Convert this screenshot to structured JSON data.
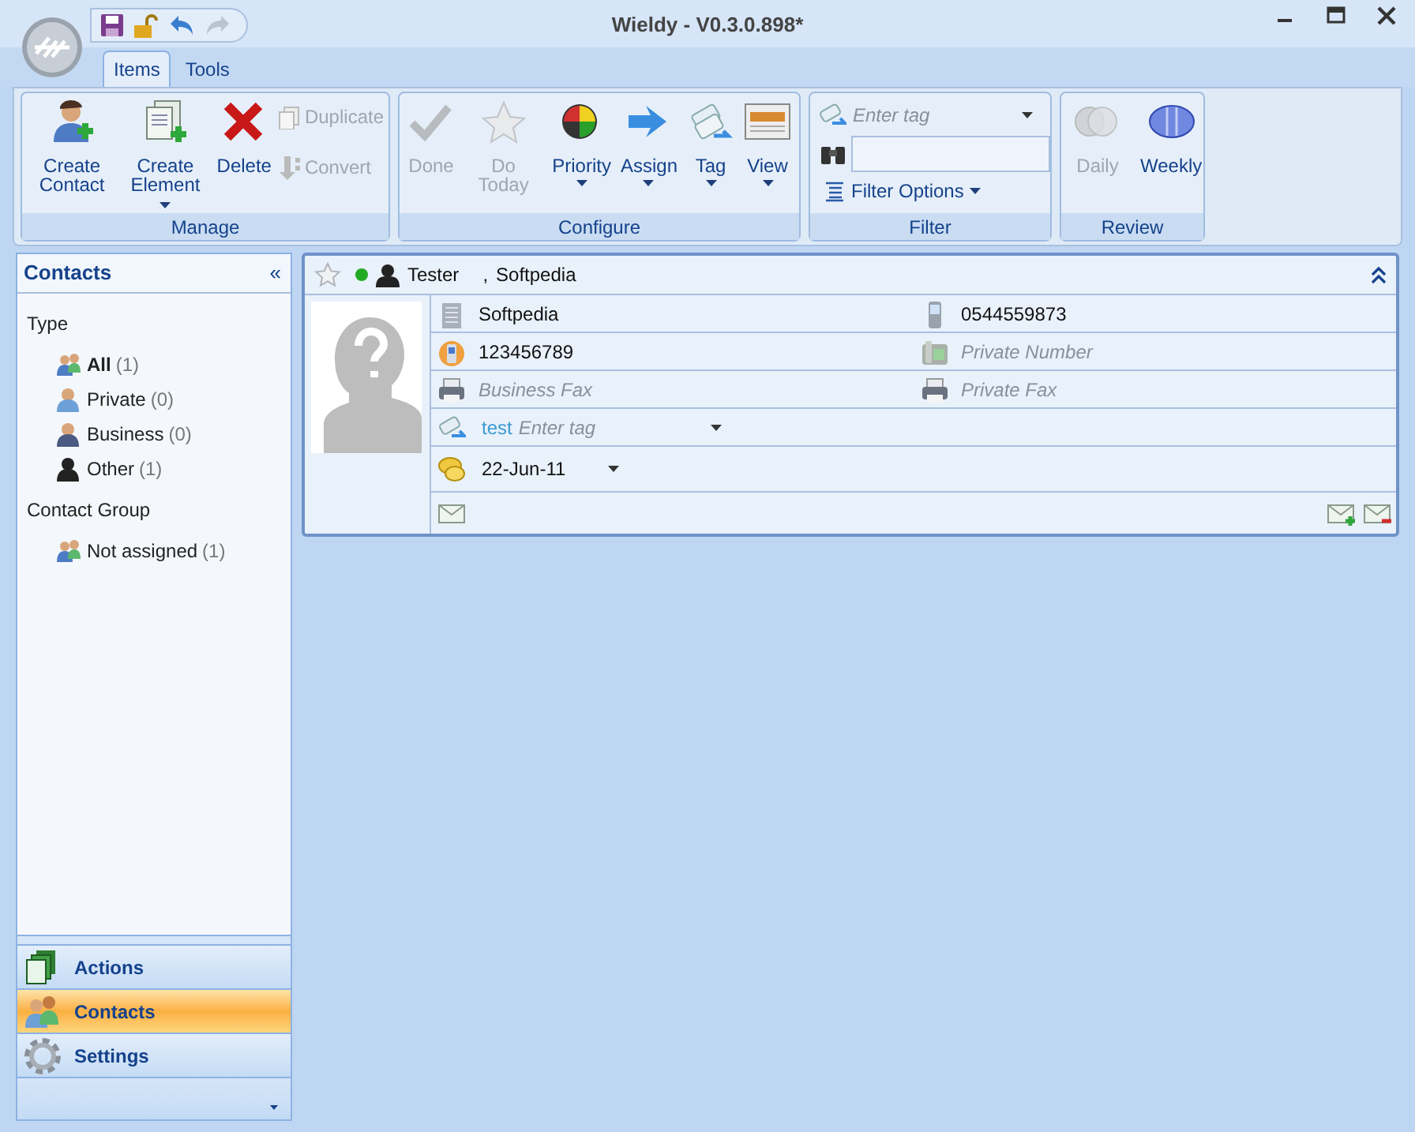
{
  "window": {
    "title": "Wieldy - V0.3.0.898*"
  },
  "tabs": [
    {
      "label": "Items",
      "selected": true
    },
    {
      "label": "Tools",
      "selected": false
    }
  ],
  "ribbon": {
    "groups": [
      {
        "label": "Manage",
        "buttons": [
          {
            "kind": "large",
            "label": "Create Contact",
            "disabled": false,
            "dropdown": false
          },
          {
            "kind": "large",
            "label": "Create Element",
            "disabled": false,
            "dropdown": true
          },
          {
            "kind": "large",
            "label": "Delete",
            "disabled": false,
            "dropdown": false
          },
          {
            "kind": "small",
            "label": "Duplicate",
            "disabled": true
          },
          {
            "kind": "small",
            "label": "Convert",
            "disabled": true
          }
        ]
      },
      {
        "label": "Configure",
        "buttons": [
          {
            "kind": "large",
            "label": "Done",
            "disabled": true,
            "dropdown": false
          },
          {
            "kind": "large",
            "label": "Do Today",
            "disabled": true,
            "dropdown": false
          },
          {
            "kind": "large",
            "label": "Priority",
            "disabled": false,
            "dropdown": true
          },
          {
            "kind": "large",
            "label": "Assign",
            "disabled": false,
            "dropdown": true
          },
          {
            "kind": "large",
            "label": "Tag",
            "disabled": false,
            "dropdown": true
          },
          {
            "kind": "large",
            "label": "View",
            "disabled": false,
            "dropdown": true
          }
        ]
      },
      {
        "label": "Filter",
        "tag_field": {
          "placeholder": "Enter tag"
        },
        "options": "Filter Options"
      },
      {
        "label": "Review",
        "buttons": [
          {
            "kind": "large",
            "label": "Daily",
            "disabled": true,
            "dropdown": false
          },
          {
            "kind": "large",
            "label": "Weekly",
            "disabled": false,
            "dropdown": false
          }
        ]
      }
    ]
  },
  "sidebar": {
    "title": "Contacts",
    "collapse": "«",
    "sections": [
      {
        "heading": "Type",
        "items": [
          {
            "label": "All",
            "count": "(1)",
            "selected": true
          },
          {
            "label": "Private",
            "count": "(0)",
            "selected": false
          },
          {
            "label": "Business",
            "count": "(0)",
            "selected": false
          },
          {
            "label": "Other",
            "count": "(1)",
            "selected": false
          }
        ]
      },
      {
        "heading": "Contact Group",
        "items": [
          {
            "label": "Not assigned",
            "count": "(1)",
            "selected": false
          }
        ]
      }
    ],
    "nav": [
      {
        "label": "Actions",
        "selected": false
      },
      {
        "label": "Contacts",
        "selected": true
      },
      {
        "label": "Settings",
        "selected": false
      }
    ]
  },
  "contact": {
    "starred": false,
    "online": true,
    "name": "Tester",
    "separator": ",",
    "company": "Softpedia",
    "fields": [
      [
        {
          "value": "Softpedia"
        },
        {
          "value": "0544559873"
        }
      ],
      [
        {
          "value": "123456789"
        },
        {
          "placeholder": "Private Number"
        }
      ],
      [
        {
          "placeholder": "Business Fax"
        },
        {
          "placeholder": "Private Fax"
        }
      ]
    ],
    "tag": {
      "value": "test",
      "placeholder": "Enter tag"
    },
    "date": "22-Jun-11"
  }
}
